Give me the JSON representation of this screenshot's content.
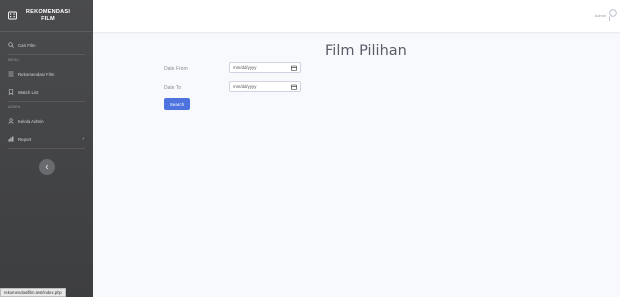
{
  "brand": {
    "line1": "REKOMENDASI",
    "line2": "FILM",
    "icon": "film-icon"
  },
  "sidebar": {
    "items": [
      {
        "label": "Cari Film",
        "icon": "search-icon"
      },
      {
        "heading": "MENU"
      },
      {
        "label": "Rekomendasi Film",
        "icon": "list-icon"
      },
      {
        "label": "Watch List",
        "icon": "bookmark-icon"
      },
      {
        "heading": "ADMIN"
      },
      {
        "label": "Kelola Admin",
        "icon": "user-icon"
      },
      {
        "label": "Report",
        "icon": "chart-icon"
      }
    ],
    "toggle_icon": "chevron-left-icon"
  },
  "topbar": {
    "user_name": "Admin",
    "avatar_icon": "user-avatar-icon"
  },
  "main": {
    "title": "Film Pilihan",
    "date_from": {
      "label": "Date From",
      "placeholder": "mm/dd/yyyy"
    },
    "date_to": {
      "label": "Date To",
      "placeholder": "mm/dd/yyyy"
    },
    "search_button": "Search"
  },
  "status_url": "rekomendasifilm.test/index.php",
  "colors": {
    "sidebar": "#4a4b4d",
    "primary": "#4e73df",
    "title": "#5a5c69"
  }
}
